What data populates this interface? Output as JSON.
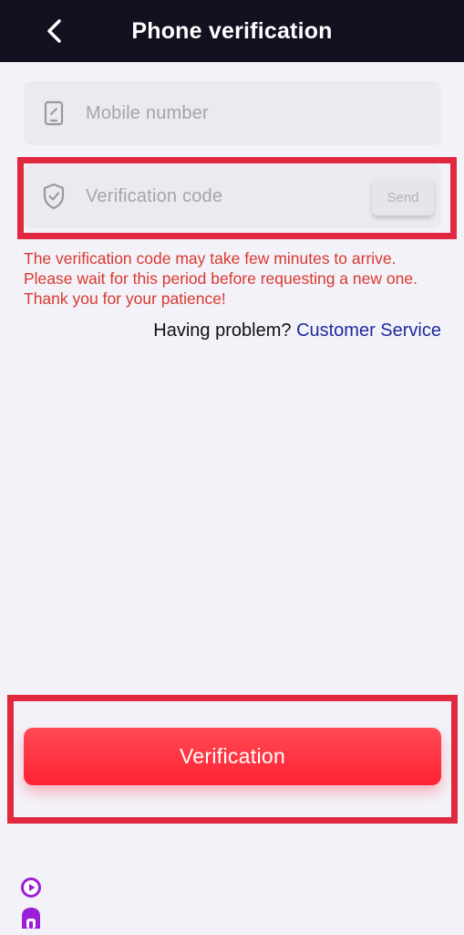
{
  "header": {
    "back_icon": "chevron-left-icon",
    "title": "Phone verification"
  },
  "form": {
    "mobile": {
      "icon": "phone-icon",
      "placeholder": "Mobile number"
    },
    "code": {
      "icon": "shield-check-icon",
      "placeholder": "Verification code",
      "send_label": "Send"
    },
    "notice": "The verification code may take few minutes to arrive. Please wait for this period before requesting a new one. Thank you for your patience!",
    "help": {
      "question": "Having problem?",
      "link": "Customer Service"
    },
    "submit_label": "Verification"
  },
  "floating_icons": [
    "play-circle-icon",
    "home-icon"
  ],
  "colors": {
    "header_bg": "#13101f",
    "page_bg": "#f3f2f8",
    "accent_red": "#ff2233",
    "notice_red": "#d9382f",
    "link_blue": "#1f2a9c",
    "highlight": "#e0283f",
    "float_icon_purple": "#9b1fd6"
  }
}
